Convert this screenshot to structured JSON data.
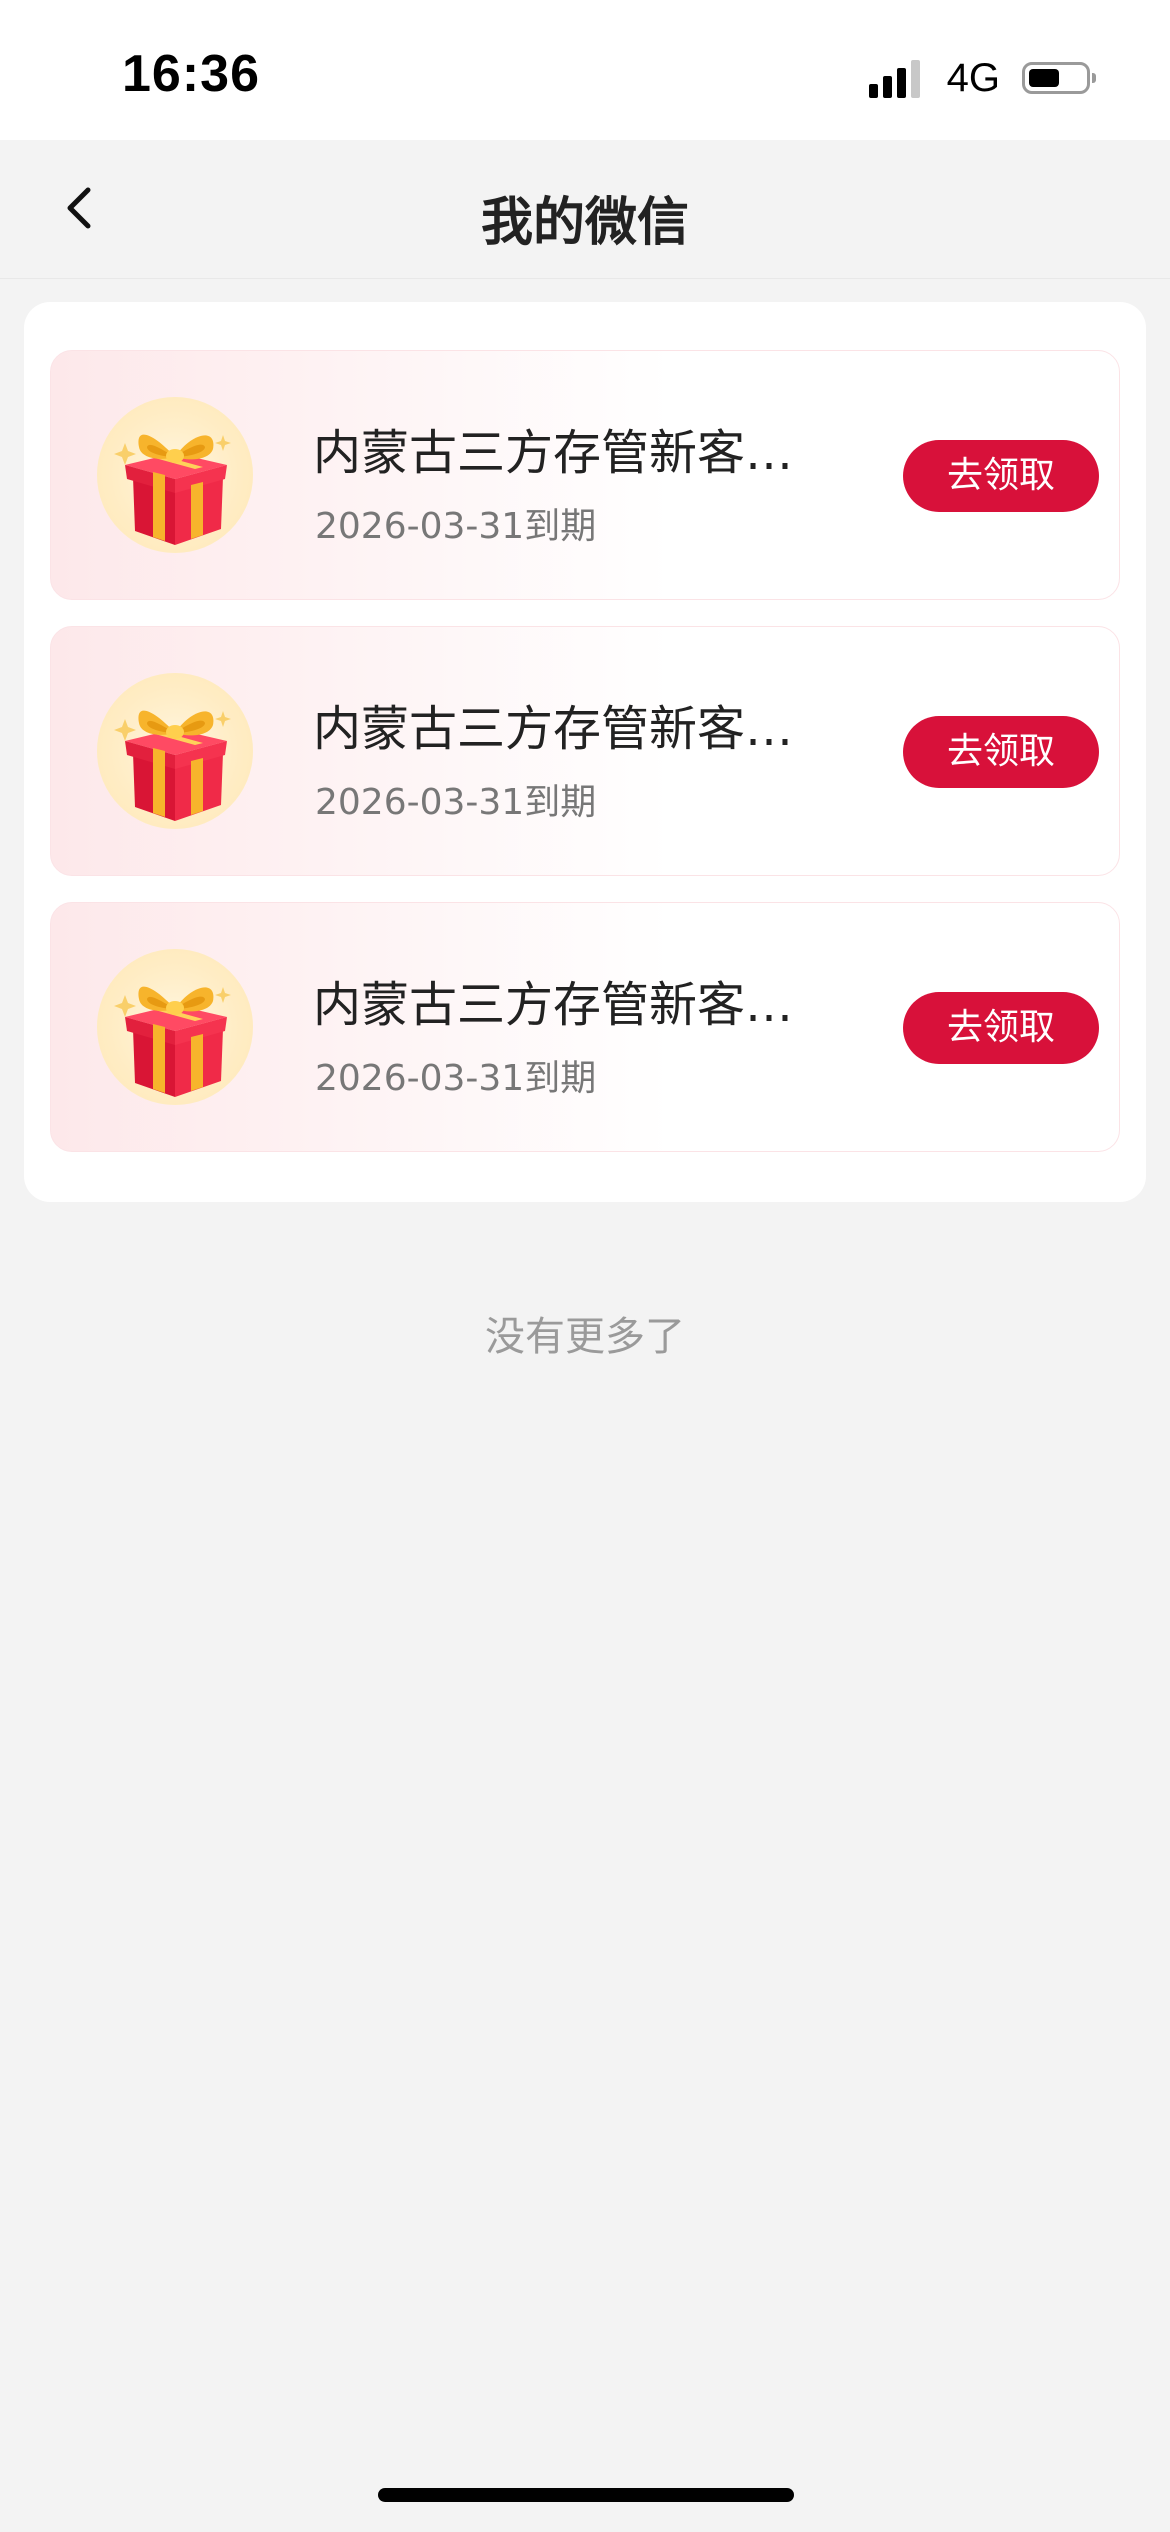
{
  "status_bar": {
    "time": "16:36",
    "network": "4G",
    "signal_bars": 3,
    "battery_level": 0.45
  },
  "nav": {
    "title": "我的微信",
    "back_icon": "chevron-left-icon"
  },
  "coupons": [
    {
      "title": "内蒙古三方存管新客…",
      "expiry": "2026-03-31到期",
      "button": "去领取",
      "icon": "gift-box-icon"
    },
    {
      "title": "内蒙古三方存管新客…",
      "expiry": "2026-03-31到期",
      "button": "去领取",
      "icon": "gift-box-icon"
    },
    {
      "title": "内蒙古三方存管新客…",
      "expiry": "2026-03-31到期",
      "button": "去领取",
      "icon": "gift-box-icon"
    }
  ],
  "footer": {
    "no_more": "没有更多了"
  },
  "colors": {
    "accent": "#d8113a",
    "background": "#f3f3f3",
    "card": "#ffffff",
    "gift_red": "#e8213f",
    "gift_ribbon": "#f7b42c"
  }
}
